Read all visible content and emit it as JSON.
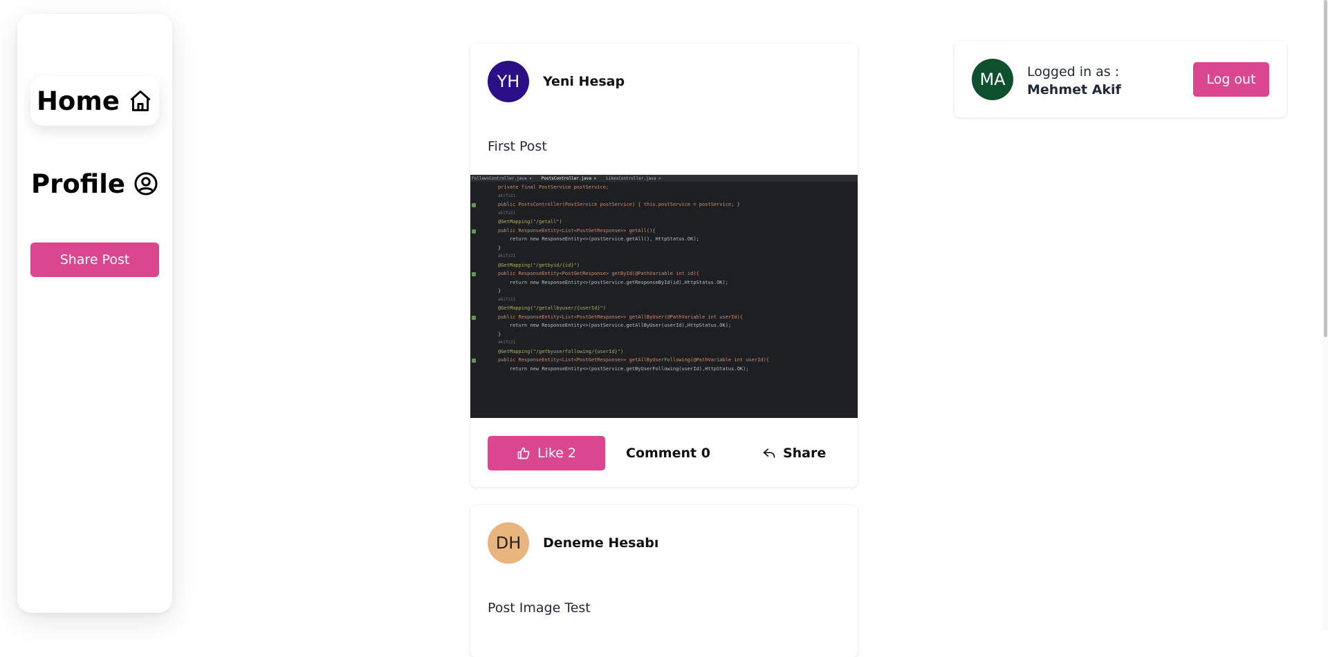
{
  "sidebar": {
    "home_label": "Home",
    "profile_label": "Profile",
    "share_post_label": "Share Post"
  },
  "posts": [
    {
      "avatar": "YH",
      "avatar_color": "#2b0f86",
      "author": "Yeni Hesap",
      "text": "First Post",
      "like_label": "Like 2",
      "comment_label": "Comment 0",
      "share_label": "Share",
      "code_tabs": [
        "FollowsController.java ×",
        "PostsController.java ×",
        "LikesController.java ×"
      ],
      "code_lines": [
        "private final PostService postService;",
        "akifz21",
        "public PostsController(PostService postService) { this.postService = postService; }",
        "akifz21",
        "@GetMapping(\"/getall\")",
        "public ResponseEntity<List<PostGetResponse>> getAll(){",
        "    return new ResponseEntity<>(postService.getAll(), HttpStatus.OK);",
        "}",
        "akifz21",
        "@GetMapping(\"/getbyid/{id}\")",
        "public ResponseEntity<PostGetResponse> getById(@PathVariable int id){",
        "    return new ResponseEntity<>(postService.getResponseById(id),HttpStatus.OK);",
        "}",
        "akifz21",
        "@GetMapping(\"/getallbyuser/{userId}\")",
        "public ResponseEntity<List<PostGetResponse>> getAllByUser(@PathVariable int userId){",
        "    return new ResponseEntity<>(postService.getAllByUser(userId),HttpStatus.OK);",
        "}",
        "akifz21",
        "@GetMapping(\"/getbyuserfollowing/{userId}\")",
        "public ResponseEntity<List<PostGetResponse>> getAllByUserFollowing(@PathVariable int userId){",
        "    return new ResponseEntity<>(postService.getByUserFollowing(userId),HttpStatus.OK);"
      ]
    },
    {
      "avatar": "DH",
      "avatar_color": "#e8b57f",
      "author": "Deneme Hesabı",
      "text": "Post Image Test"
    }
  ],
  "user_card": {
    "avatar": "MA",
    "avatar_color": "#0e4f2e",
    "logged_in_label": "Logged in as :",
    "user_name": "Mehmet Akif",
    "logout_label": "Log out"
  },
  "colors": {
    "accent": "#db4691"
  },
  "icons": {
    "home": "home-icon",
    "profile": "user-circle-icon",
    "like": "thumbs-up-icon",
    "share": "reply-arrow-icon"
  }
}
